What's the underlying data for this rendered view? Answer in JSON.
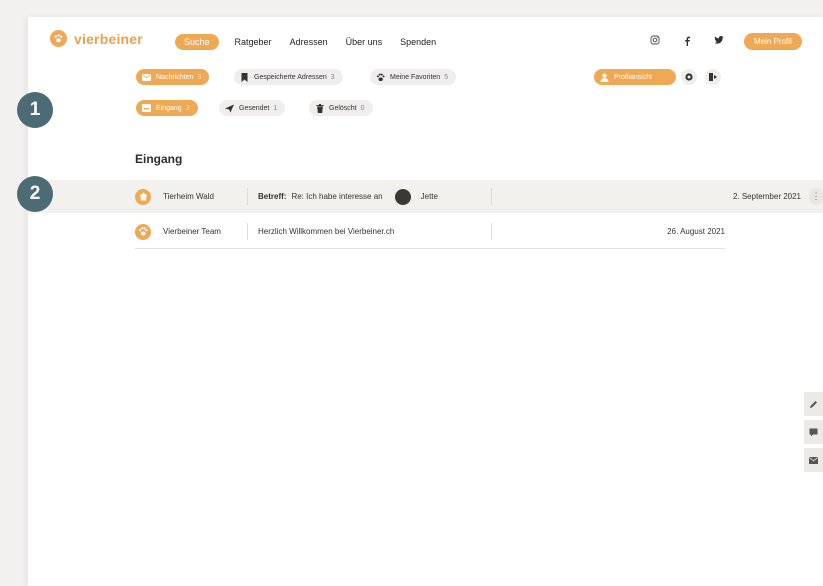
{
  "header": {
    "logo_text": "vierbeiner",
    "nav": [
      {
        "label": "Suche",
        "active": true
      },
      {
        "label": "Ratgeber"
      },
      {
        "label": "Adressen"
      },
      {
        "label": "Über uns"
      },
      {
        "label": "Spenden"
      }
    ],
    "social_icons": [
      "instagram-icon",
      "facebook-icon",
      "twitter-icon"
    ],
    "profile_button": "Mein Profil"
  },
  "tabs_row1": {
    "nachrichten": {
      "label": "Nachrichten",
      "count": "3"
    },
    "gespeicherte_adressen": {
      "label": "Gespeicherte Adressen",
      "count": "3"
    },
    "meine_favoriten": {
      "label": "Meine Favoriten",
      "count": "5"
    },
    "profil_button": "Profilansicht"
  },
  "tabs_row2": {
    "eingang": {
      "label": "Eingang",
      "count": "3"
    },
    "gesendet": {
      "label": "Gesendet",
      "count": "1"
    },
    "geloescht": {
      "label": "Gelöscht",
      "count": "0"
    }
  },
  "inbox": {
    "title": "Eingang",
    "messages": [
      {
        "sender": "Tierheim Wald",
        "subject_label": "Betreff:",
        "subject": "Re: Ich habe interesse an",
        "pet_name": "Jette",
        "date": "2. September 2021"
      },
      {
        "sender": "Vierbeiner Team",
        "subject_label": "",
        "subject": "Herzlich Willkommen bei Vierbeiner.ch",
        "pet_name": "",
        "date": "26. August 2021"
      }
    ]
  },
  "badges": [
    "1",
    "2"
  ],
  "colors": {
    "accent": "#efa954",
    "badge": "#4c6b74",
    "pill_bg": "#efeeec"
  }
}
